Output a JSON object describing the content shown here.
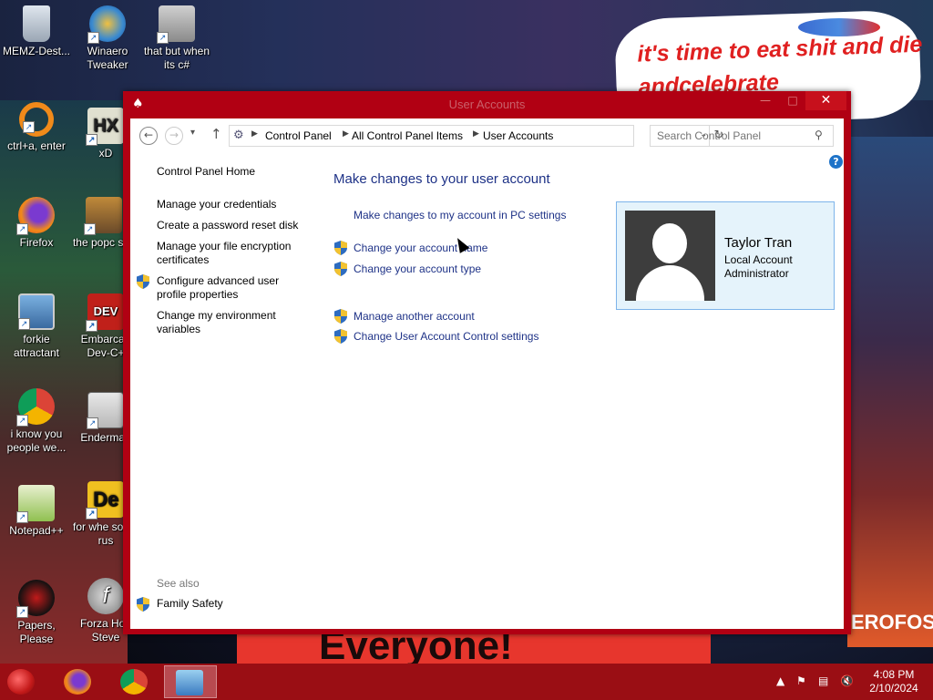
{
  "wallpaper": {
    "bubble_text": "it's time to eat shit and die andcelebrate",
    "banner_text": "Everyone!",
    "corner_text": "EROFOS"
  },
  "desktop_icons": [
    {
      "label": "MEMZ-Dest...",
      "icon": "recycle-bin-icon"
    },
    {
      "label": "Winaero Tweaker",
      "icon": "winaero-icon"
    },
    {
      "label": "that but when its c#",
      "icon": "stacked-windows-icon"
    },
    {
      "label": "ctrl+a, enter",
      "icon": "ring-icon"
    },
    {
      "label": "xD",
      "icon": "hxd-icon"
    },
    {
      "label": "Firefox",
      "icon": "firefox-icon"
    },
    {
      "label": "the popc shit",
      "icon": "popcorn-icon"
    },
    {
      "label": "forkie attractant",
      "icon": "monitor-gear-icon"
    },
    {
      "label": "Embarcad Dev-C+",
      "icon": "devcpp-icon"
    },
    {
      "label": "i know you people we...",
      "icon": "chrome-icon"
    },
    {
      "label": "Enderman",
      "icon": "window-icon"
    },
    {
      "label": "Notepad++",
      "icon": "notepadpp-icon"
    },
    {
      "label": "for whe some rus",
      "icon": "de-icon"
    },
    {
      "label": "Papers, Please",
      "icon": "papers-please-icon"
    },
    {
      "label": "Forza Hori Steve",
      "icon": "flash-icon"
    }
  ],
  "window": {
    "title": "User Accounts",
    "address": {
      "crumbs": [
        "Control Panel",
        "All Control Panel Items",
        "User Accounts"
      ]
    },
    "search": {
      "placeholder": "Search Control Panel"
    },
    "left_pane": {
      "home": "Control Panel Home",
      "links": [
        "Manage your credentials",
        "Create a password reset disk",
        "Manage your file encryption certificates",
        "Configure advanced user profile properties",
        "Change my environment variables"
      ],
      "see_also": "See also",
      "family_safety": "Family Safety"
    },
    "main": {
      "title": "Make changes to your user account",
      "pc_settings_link": "Make changes to my account in PC settings",
      "tasks": [
        "Change your account name",
        "Change your account type",
        "Manage another account",
        "Change User Account Control settings"
      ]
    },
    "account": {
      "name": "Taylor Tran",
      "type": "Local Account",
      "role": "Administrator"
    }
  },
  "taskbar": {
    "apps": [
      "Firefox",
      "Chrome",
      "Control Panel"
    ],
    "time": "4:08 PM",
    "date": "2/10/2024"
  },
  "colors": {
    "window_frame": "#b10013",
    "link_blue": "#1e3287",
    "taskbar": "#9a0e14",
    "card_bg": "#e5f3fb"
  }
}
